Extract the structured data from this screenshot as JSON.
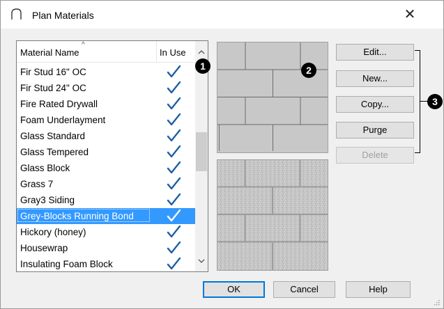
{
  "dialog": {
    "title": "Plan Materials",
    "close_glyph": "✕"
  },
  "list": {
    "columns": [
      "Material Name",
      "In Use"
    ],
    "sort_indicator": "^",
    "selected_index": 9,
    "rows": [
      {
        "name": "Fir Stud 16\" OC",
        "in_use": true
      },
      {
        "name": "Fir Stud 24\" OC",
        "in_use": true
      },
      {
        "name": "Fire Rated Drywall",
        "in_use": true
      },
      {
        "name": "Foam Underlayment",
        "in_use": true
      },
      {
        "name": "Glass  Standard",
        "in_use": true
      },
      {
        "name": "Glass  Tempered",
        "in_use": true
      },
      {
        "name": "Glass Block",
        "in_use": true
      },
      {
        "name": "Grass 7",
        "in_use": true
      },
      {
        "name": "Gray3 Siding",
        "in_use": true
      },
      {
        "name": "Grey-Blocks Running Bond",
        "in_use": true
      },
      {
        "name": "Hickory (honey)",
        "in_use": true
      },
      {
        "name": "Housewrap",
        "in_use": true
      },
      {
        "name": "Insulating Foam Block",
        "in_use": true
      }
    ]
  },
  "buttons": {
    "edit": "Edit...",
    "new": "New...",
    "copy": "Copy...",
    "purge": "Purge",
    "delete": "Delete",
    "ok": "OK",
    "cancel": "Cancel",
    "help": "Help"
  },
  "callouts": {
    "one": "1",
    "two": "2",
    "three": "3"
  },
  "colors": {
    "selection": "#3399ff",
    "check": "#1a5fa0",
    "accent": "#0078d7"
  },
  "icons": {
    "title": "arch-icon",
    "close": "close-icon",
    "check": "checkmark-icon",
    "scroll_up": "scroll-up-arrow-icon",
    "scroll_down": "scroll-down-arrow-icon",
    "resize": "resize-grip-icon"
  }
}
